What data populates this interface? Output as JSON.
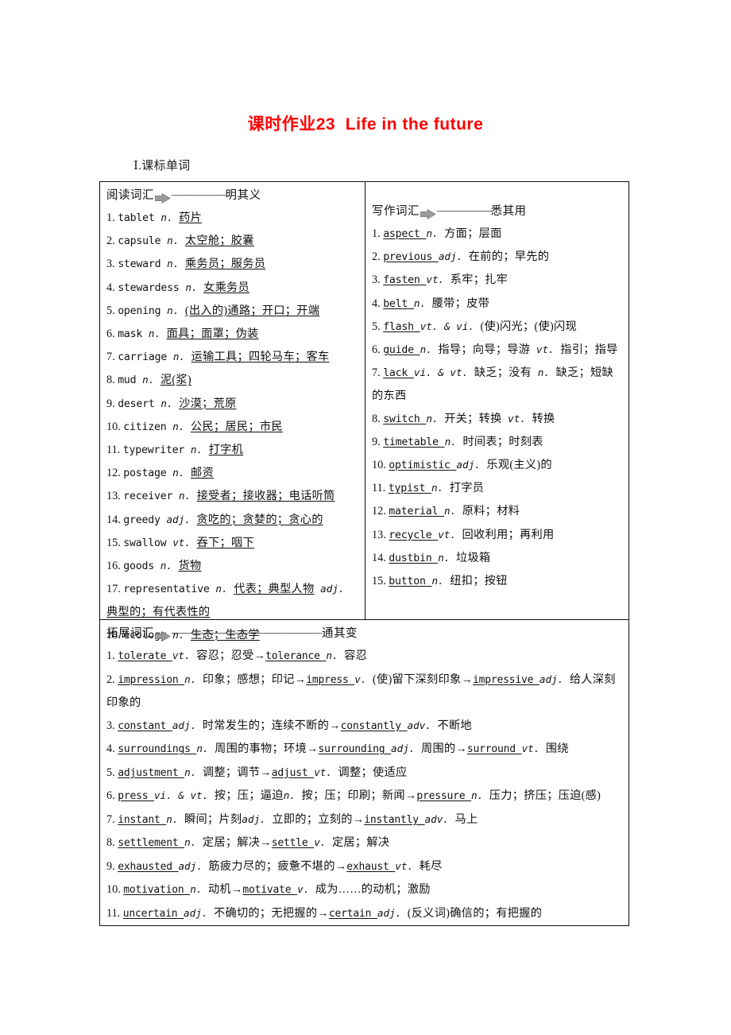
{
  "document": {
    "title": "课时作业23  Life in the future",
    "title_color": "#ff0000",
    "section_heading": "Ⅰ.课标单词"
  },
  "reading_vocab": {
    "banner_label": "阅读词汇",
    "banner_arrow_icon": "arrow-right-icon",
    "banner_dashes": "—————",
    "banner_suffix": "明其义",
    "items": [
      {
        "num": "1.",
        "word": "tablet",
        "pos": "n.",
        "cn": "药片"
      },
      {
        "num": "2.",
        "word": "capsule",
        "pos": "n.",
        "cn": "太空舱；胶囊"
      },
      {
        "num": "3.",
        "word": "steward",
        "pos": "n.",
        "cn": "乘务员；服务员"
      },
      {
        "num": "4.",
        "word": "stewardess",
        "pos": "n.",
        "cn": "女乘务员"
      },
      {
        "num": "5.",
        "word": "opening",
        "pos": "n.",
        "cn": "(出入的)通路；开口；开端"
      },
      {
        "num": "6.",
        "word": "mask",
        "pos": "n.",
        "cn": "面具；面罩；伪装"
      },
      {
        "num": "7.",
        "word": "carriage",
        "pos": "n.",
        "cn": "运输工具；四轮马车；客车"
      },
      {
        "num": "8.",
        "word": "mud",
        "pos": "n.",
        "cn": "泥(浆)"
      },
      {
        "num": "9.",
        "word": "desert",
        "pos": "n.",
        "cn": "沙漠；荒原"
      },
      {
        "num": "10.",
        "word": "citizen",
        "pos": "n.",
        "cn": "公民；居民；市民"
      },
      {
        "num": "11.",
        "word": "typewriter",
        "pos": "n.",
        "cn": "打字机"
      },
      {
        "num": "12.",
        "word": "postage",
        "pos": "n.",
        "cn": "邮资"
      },
      {
        "num": "13.",
        "word": "receiver",
        "pos": "n.",
        "cn": "接受者；接收器；电话听筒"
      },
      {
        "num": "14.",
        "word": "greedy",
        "pos": "adj.",
        "cn": "贪吃的；贪婪的；贪心的"
      },
      {
        "num": "15.",
        "word": "swallow",
        "pos": "vt.",
        "cn": "吞下；咽下"
      },
      {
        "num": "16.",
        "word": "goods",
        "pos": "n.",
        "cn": "货物"
      },
      {
        "num": "17.",
        "word": "representative",
        "pos": "n.",
        "cn": "代表；典型人物",
        "pos2": "adj.",
        "cn2": "典型的；有代表性的"
      },
      {
        "num": "18.",
        "word": "ecology",
        "pos": "n.",
        "cn": "生态；生态学"
      }
    ]
  },
  "writing_vocab": {
    "banner_label": "写作词汇",
    "banner_arrow_icon": "arrow-right-icon",
    "banner_dashes": "—————",
    "banner_suffix": "悉其用",
    "items": [
      {
        "num": "1.",
        "word": "aspect",
        "pos": "n.",
        "cn": "方面；层面"
      },
      {
        "num": "2.",
        "word": "previous",
        "pos": "adj.",
        "cn": "在前的；早先的"
      },
      {
        "num": "3.",
        "word": "fasten",
        "pos": "vt.",
        "cn": "系牢；扎牢"
      },
      {
        "num": "4.",
        "word": "belt",
        "pos": "n.",
        "cn": "腰带；皮带"
      },
      {
        "num": "5.",
        "word": "flash",
        "pos": "vt. & vi.",
        "cn": "(使)闪光；(使)闪现"
      },
      {
        "num": "6.",
        "word": "guide",
        "pos": "n.",
        "cn": "指导；向导；导游",
        "pos2": "vt.",
        "cn2": "指引；指导"
      },
      {
        "num": "7.",
        "word": "lack",
        "pos": "vi. & vt.",
        "cn": "缺乏；没有",
        "pos2": "n.",
        "cn2": "缺乏；短缺的东西"
      },
      {
        "num": "8.",
        "word": "switch",
        "pos": "n.",
        "cn": "开关；转换",
        "pos2": "vt.",
        "cn2": "转换"
      },
      {
        "num": "9.",
        "word": "timetable",
        "pos": "n.",
        "cn": "时间表；时刻表"
      },
      {
        "num": "10.",
        "word": "optimistic",
        "pos": "adj.",
        "cn": "乐观(主义)的"
      },
      {
        "num": "11.",
        "word": "typist",
        "pos": "n.",
        "cn": "打字员"
      },
      {
        "num": "12.",
        "word": "material",
        "pos": "n.",
        "cn": "原料；材料"
      },
      {
        "num": "13.",
        "word": "recycle",
        "pos": "vt.",
        "cn": "回收利用；再利用"
      },
      {
        "num": "14.",
        "word": "dustbin",
        "pos": "n.",
        "cn": "垃圾箱"
      },
      {
        "num": "15.",
        "word": "button",
        "pos": "n.",
        "cn": "纽扣；按钮"
      }
    ]
  },
  "extended_vocab": {
    "banner_label": "拓展词汇",
    "banner_arrow_icon": "arrow-right-icon",
    "banner_dashes": "——————————————",
    "banner_suffix": "通其变",
    "items": [
      {
        "num": "1.",
        "parts": [
          {
            "word": "tolerate",
            "pos": "vt.",
            "cn": "容忍；忍受"
          },
          {
            "arrow": "→",
            "word": "tolerance",
            "pos": "n.",
            "cn": "容忍"
          }
        ]
      },
      {
        "num": "2.",
        "parts": [
          {
            "word": "impression",
            "pos": "n.",
            "cn": "印象；感想；印记"
          },
          {
            "arrow": "→",
            "word": "impress",
            "pos": "v.",
            "cn": "(使)留下深刻印象"
          },
          {
            "arrow": "→",
            "word": "impressive",
            "pos": "adj.",
            "cn": "给人深刻印象的"
          }
        ]
      },
      {
        "num": "3.",
        "parts": [
          {
            "word": "constant",
            "pos": "adj.",
            "cn": "时常发生的；连续不断的"
          },
          {
            "arrow": "→",
            "word": "constantly",
            "pos": "adv.",
            "cn": "不断地"
          }
        ]
      },
      {
        "num": "4.",
        "parts": [
          {
            "word": "surroundings",
            "pos": "n.",
            "cn": "周围的事物；环境"
          },
          {
            "arrow": "→",
            "word": "surrounding",
            "pos": "adj.",
            "cn": "周围的"
          },
          {
            "arrow": "→",
            "word": "surround",
            "pos": "vt.",
            "cn": "围绕"
          }
        ]
      },
      {
        "num": "5.",
        "parts": [
          {
            "word": "adjustment",
            "pos": "n.",
            "cn": "调整；调节"
          },
          {
            "arrow": "→",
            "word": "adjust",
            "pos": "vt.",
            "cn": "调整；使适应"
          }
        ]
      },
      {
        "num": "6.",
        "parts": [
          {
            "word": "press",
            "pos": "vi. & vt.",
            "cn": "按；压；逼迫"
          },
          {
            "pos": "n.",
            "cn": "按；压；印刷；新闻"
          },
          {
            "arrow": "→",
            "word": "pressure",
            "pos": "n.",
            "cn": "压力；挤压；压迫(感)"
          }
        ]
      },
      {
        "num": "7.",
        "parts": [
          {
            "word": "instant",
            "pos": "n.",
            "cn": "瞬间；片刻"
          },
          {
            "pos": "adj.",
            "cn": "立即的；立刻的"
          },
          {
            "arrow": "→",
            "word": "instantly",
            "pos": "adv.",
            "cn": "马上"
          }
        ]
      },
      {
        "num": "8.",
        "parts": [
          {
            "word": "settlement",
            "pos": "n.",
            "cn": "定居；解决"
          },
          {
            "arrow": "→",
            "word": "settle",
            "pos": "v.",
            "cn": "定居；解决"
          }
        ]
      },
      {
        "num": "9.",
        "parts": [
          {
            "word": "exhausted",
            "pos": "adj.",
            "cn": "筋疲力尽的；疲惫不堪的"
          },
          {
            "arrow": "→",
            "word": "exhaust",
            "pos": "vt.",
            "cn": "耗尽"
          }
        ]
      },
      {
        "num": "10.",
        "parts": [
          {
            "word": "motivation",
            "pos": "n.",
            "cn": "动机"
          },
          {
            "arrow": "→",
            "word": "motivate",
            "pos": "v.",
            "cn": "成为……的动机；激励"
          }
        ]
      },
      {
        "num": "11.",
        "parts": [
          {
            "word": "uncertain",
            "pos": "adj.",
            "cn": "不确切的；无把握的"
          },
          {
            "arrow": "→",
            "word": "certain",
            "pos": "adj.",
            "cn": "(反义词)确信的；有把握的"
          }
        ]
      }
    ]
  }
}
